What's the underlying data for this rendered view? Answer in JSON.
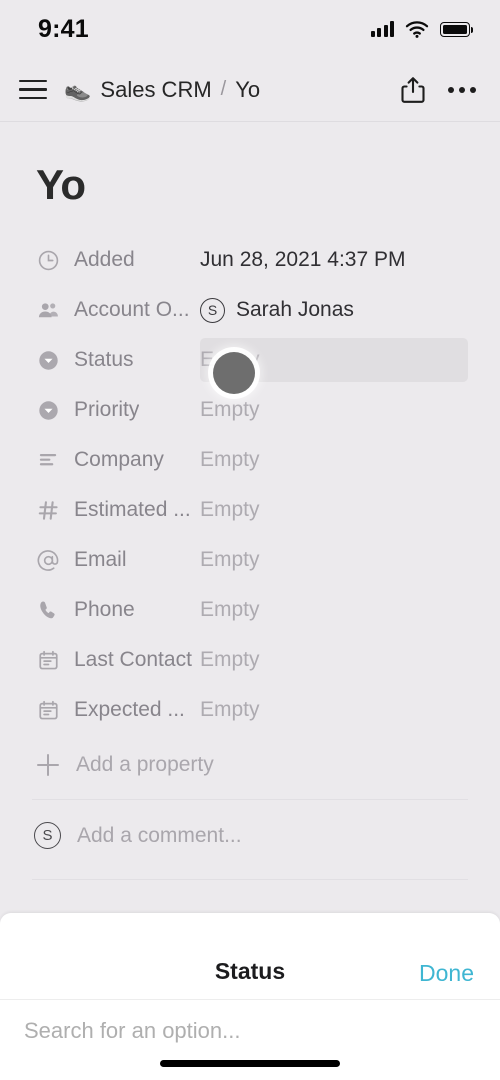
{
  "status_bar": {
    "time": "9:41",
    "signal_icon": "cellular-signal-icon",
    "wifi_icon": "wifi-icon",
    "battery_icon": "battery-full-icon"
  },
  "header": {
    "menu_icon": "hamburger-menu-icon",
    "database_emoji": "👟",
    "database_name": "Sales CRM",
    "separator": "/",
    "page_name": "Yo",
    "share_icon": "share-icon",
    "more_icon": "more-options-icon"
  },
  "page": {
    "title": "Yo",
    "properties": [
      {
        "icon": "clock-icon",
        "label": "Added",
        "value": "Jun 28, 2021 4:37 PM",
        "empty": false,
        "highlighted": false,
        "avatar": null
      },
      {
        "icon": "person-icon",
        "label": "Account O...",
        "value": "Sarah Jonas",
        "empty": false,
        "highlighted": false,
        "avatar": "S"
      },
      {
        "icon": "select-icon",
        "label": "Status",
        "value": "Empty",
        "empty": true,
        "highlighted": true,
        "avatar": null
      },
      {
        "icon": "select-icon",
        "label": "Priority",
        "value": "Empty",
        "empty": true,
        "highlighted": false,
        "avatar": null
      },
      {
        "icon": "text-lines-icon",
        "label": "Company",
        "value": "Empty",
        "empty": true,
        "highlighted": false,
        "avatar": null
      },
      {
        "icon": "hash-icon",
        "label": "Estimated ...",
        "value": "Empty",
        "empty": true,
        "highlighted": false,
        "avatar": null
      },
      {
        "icon": "at-icon",
        "label": "Email",
        "value": "Empty",
        "empty": true,
        "highlighted": false,
        "avatar": null
      },
      {
        "icon": "phone-icon",
        "label": "Phone",
        "value": "Empty",
        "empty": true,
        "highlighted": false,
        "avatar": null
      },
      {
        "icon": "calendar-icon",
        "label": "Last Contact",
        "value": "Empty",
        "empty": true,
        "highlighted": false,
        "avatar": null
      },
      {
        "icon": "calendar-icon",
        "label": "Expected ...",
        "value": "Empty",
        "empty": true,
        "highlighted": false,
        "avatar": null
      }
    ],
    "add_property_label": "Add a property",
    "add_property_icon": "plus-icon",
    "comment": {
      "avatar_initial": "S",
      "placeholder": "Add a comment..."
    }
  },
  "touch_indicator": {
    "name": "touch-point-indicator",
    "color": "#6E6E6E"
  },
  "bottom_sheet": {
    "title": "Status",
    "done_label": "Done",
    "done_color": "#3FB6D2",
    "search_placeholder": "Search for an option..."
  },
  "home_indicator": "home-indicator-bar",
  "colors": {
    "background": "#ECEAED",
    "highlight": "#E0DEE1",
    "sheet_background": "#FFFFFF",
    "accent": "#3FB6D2"
  }
}
